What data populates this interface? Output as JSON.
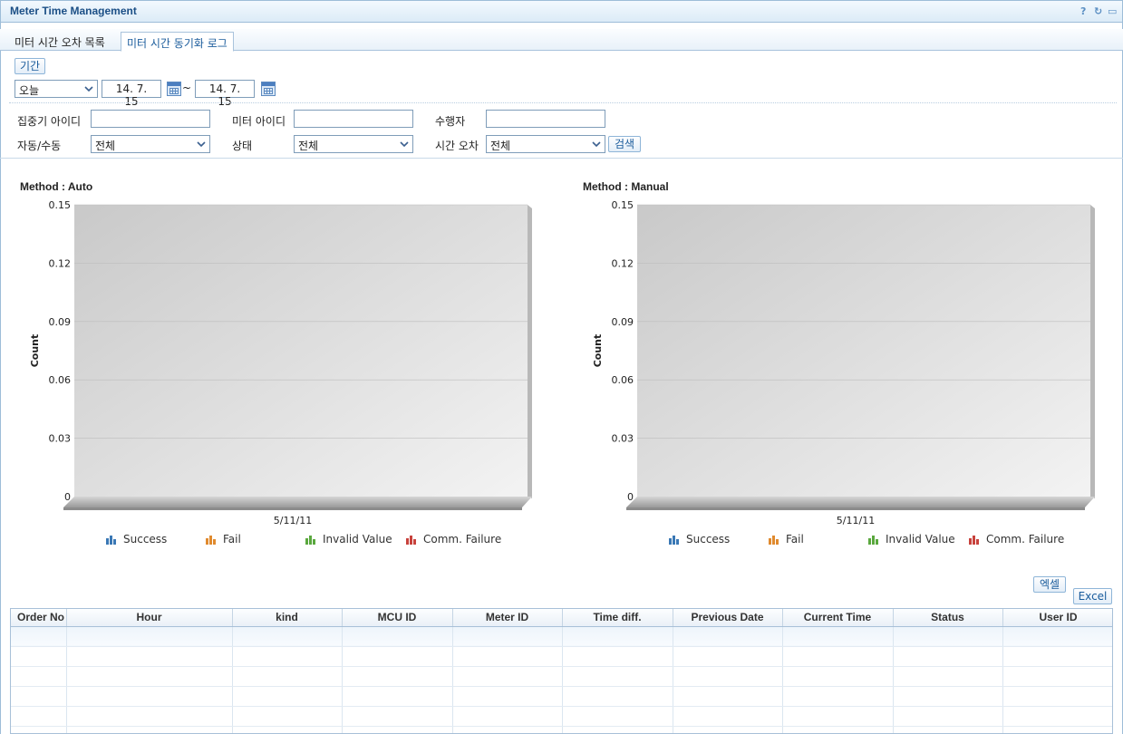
{
  "window": {
    "title": "Meter Time Management",
    "tools": [
      {
        "name": "help-icon",
        "glyph": "?"
      },
      {
        "name": "refresh-icon",
        "glyph": "↻"
      },
      {
        "name": "maximize-icon",
        "glyph": "▭"
      }
    ]
  },
  "tabs": [
    {
      "label": "미터 시간 오차 목록",
      "active": false
    },
    {
      "label": "미터 시간 동기화 로그",
      "active": true
    }
  ],
  "period": {
    "button_label": "기간",
    "range_select": "오늘",
    "start_date": "14. 7. 15",
    "separator": "~",
    "end_date": "14. 7. 15"
  },
  "filters": {
    "concentrator_id_label": "집중기 아이디",
    "concentrator_id_value": "",
    "meter_id_label": "미터 아이디",
    "meter_id_value": "",
    "operator_label": "수행자",
    "operator_value": "",
    "auto_manual_label": "자동/수동",
    "auto_manual_value": "전체",
    "status_label": "상태",
    "status_value": "전체",
    "time_diff_label": "시간 오차",
    "time_diff_value": "전체",
    "search_label": "검색"
  },
  "chart_data": [
    {
      "type": "bar",
      "title": "Method : Auto",
      "categories": [
        "5/11/11"
      ],
      "series": [
        {
          "name": "Success",
          "values": [
            0
          ],
          "color": "#3a78b5"
        },
        {
          "name": "Fail",
          "values": [
            0
          ],
          "color": "#e08a2e"
        },
        {
          "name": "Invalid Value",
          "values": [
            0
          ],
          "color": "#5aa83e"
        },
        {
          "name": "Comm. Failure",
          "values": [
            0
          ],
          "color": "#c8423c"
        }
      ],
      "ylabel": "Count",
      "ylim": [
        0,
        0.15
      ],
      "yticks": [
        "0",
        "0.03",
        "0.06",
        "0.09",
        "0.12",
        "0.15"
      ],
      "legend": "bottom"
    },
    {
      "type": "bar",
      "title": "Method : Manual",
      "categories": [
        "5/11/11"
      ],
      "series": [
        {
          "name": "Success",
          "values": [
            0
          ],
          "color": "#3a78b5"
        },
        {
          "name": "Fail",
          "values": [
            0
          ],
          "color": "#e08a2e"
        },
        {
          "name": "Invalid Value",
          "values": [
            0
          ],
          "color": "#5aa83e"
        },
        {
          "name": "Comm. Failure",
          "values": [
            0
          ],
          "color": "#c8423c"
        }
      ],
      "ylabel": "Count",
      "ylim": [
        0,
        0.15
      ],
      "yticks": [
        "0",
        "0.03",
        "0.06",
        "0.09",
        "0.12",
        "0.15"
      ],
      "legend": "bottom"
    }
  ],
  "export": {
    "excel_kr_label": "엑셀",
    "excel_label": "Excel"
  },
  "table": {
    "columns": [
      "Order No",
      "Hour",
      "kind",
      "MCU ID",
      "Meter ID",
      "Time diff.",
      "Previous Date",
      "Current Time",
      "Status",
      "User ID"
    ],
    "rows": []
  }
}
